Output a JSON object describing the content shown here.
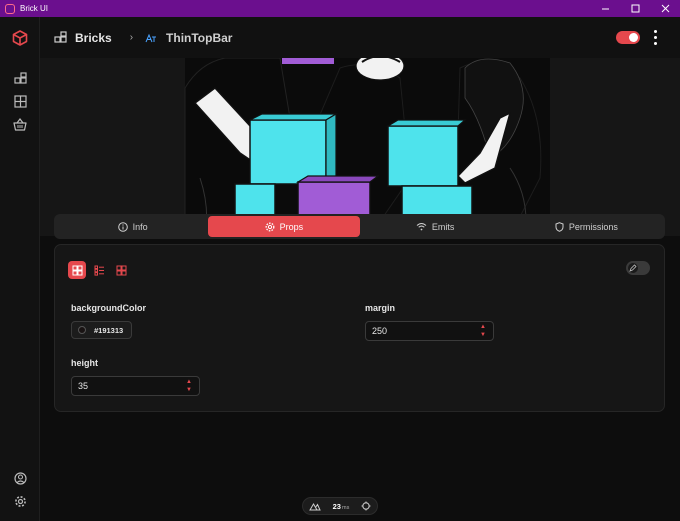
{
  "window": {
    "title": "Brick UI",
    "controls": [
      "minimize",
      "maximize",
      "close"
    ]
  },
  "sidebar": {
    "items": [
      {
        "icon": "cube-logo-icon"
      },
      {
        "icon": "bricks-icon"
      },
      {
        "icon": "grid-icon"
      },
      {
        "icon": "basket-icon"
      }
    ],
    "bottom": [
      {
        "icon": "user-circle-icon"
      },
      {
        "icon": "settings-icon"
      }
    ]
  },
  "header": {
    "breadcrumb_root": "Bricks",
    "breadcrumb_current": "ThinTopBar",
    "toggle_on": true
  },
  "tabs": [
    {
      "label": "Info",
      "icon": "info-icon",
      "active": false
    },
    {
      "label": "Props",
      "icon": "gear-icon",
      "active": true
    },
    {
      "label": "Emits",
      "icon": "wifi-icon",
      "active": false
    },
    {
      "label": "Permissions",
      "icon": "shield-icon",
      "active": false
    }
  ],
  "props": {
    "backgroundColor": {
      "label": "backgroundColor",
      "value": "#191313"
    },
    "margin": {
      "label": "margin",
      "value": "250"
    },
    "height": {
      "label": "height",
      "value": "35"
    }
  },
  "status": {
    "render_time": "23",
    "unit": "ms"
  },
  "colors": {
    "accent": "#e5484d",
    "titlebar": "#6b0f8e",
    "cyan": "#4ee3ec",
    "purple": "#a15cd6"
  }
}
